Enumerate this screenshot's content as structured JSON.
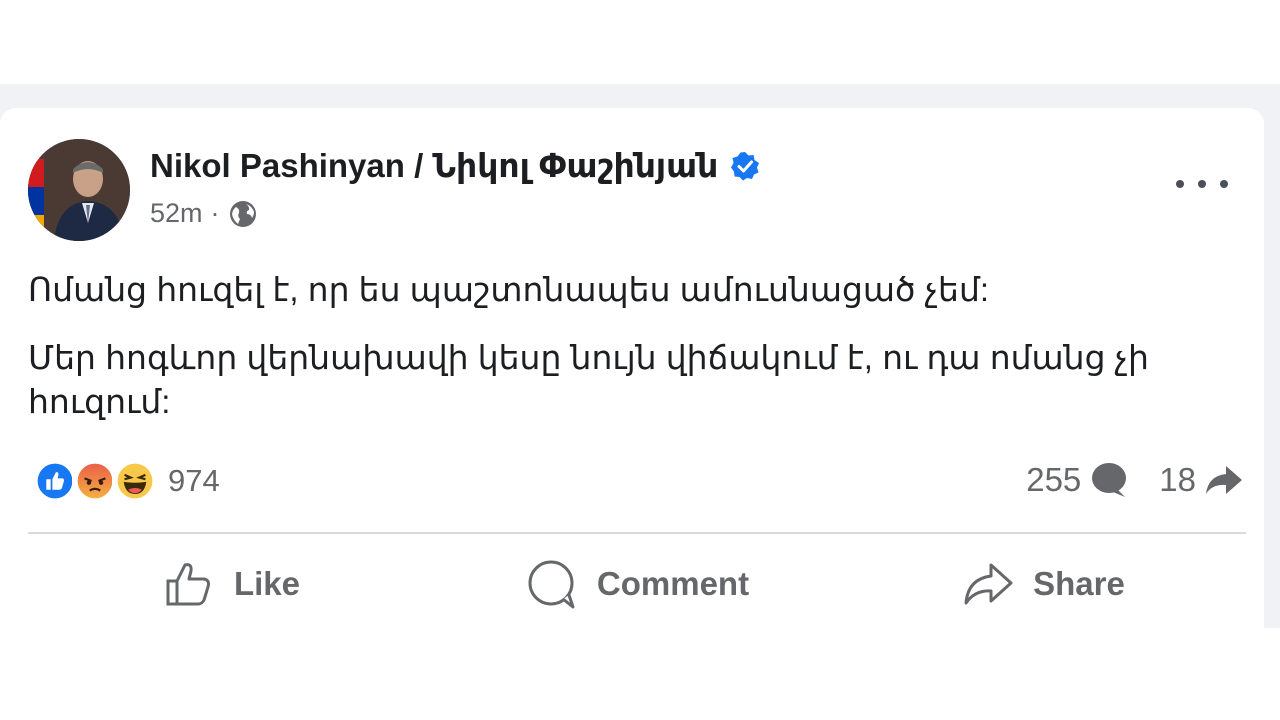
{
  "post": {
    "author": "Nikol Pashinyan / Նիկոլ Փաշինյան",
    "time": "52m",
    "separator": "·",
    "visibility_icon": "globe-icon",
    "verified_icon": "verified-badge-icon",
    "paragraphs": [
      "Ոմանց հուզել է, որ ես պաշտոնապես ամուսնացած չեմ:",
      "Մեր հոգևոր վերնախավի կեսը նույն վիճակում է, ու դա ոմանց չի հուզում:"
    ]
  },
  "reactions": {
    "icons": [
      "like-icon",
      "angry-icon",
      "haha-icon"
    ],
    "count": "974"
  },
  "stats": {
    "comments": "255",
    "shares": "18"
  },
  "actions": {
    "like": "Like",
    "comment": "Comment",
    "share": "Share"
  },
  "colors": {
    "accent": "#1877f2",
    "text": "#1c1e21",
    "muted": "#65676b",
    "background": "#f0f2f5"
  }
}
